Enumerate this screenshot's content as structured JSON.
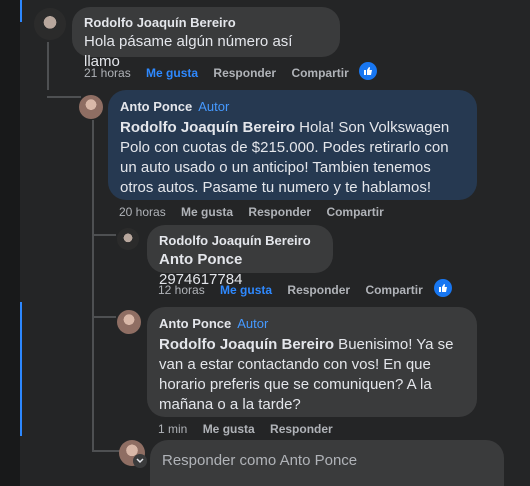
{
  "comment1": {
    "author": "Rodolfo Joaquín Bereiro",
    "text": "Hola pásame algún número así llamo",
    "time": "21 horas",
    "like_label": "Me gusta",
    "reply_label": "Responder",
    "share_label": "Compartir",
    "liked": true
  },
  "reply1": {
    "author": "Anto Ponce",
    "badge": "Autor",
    "mention": "Rodolfo Joaquín Bereiro",
    "text": " Hola! Son Volkswagen Polo con cuotas de $215.000. Podes retirarlo con un auto usado o un anticipo! Tambien tenemos otros autos. Pasame tu numero y te hablamos!",
    "time": "20 horas",
    "like_label": "Me gusta",
    "reply_label": "Responder",
    "share_label": "Compartir"
  },
  "reply2": {
    "author": "Rodolfo Joaquín Bereiro",
    "mention": "Anto Ponce",
    "text": " 2974617784",
    "time": "12 horas",
    "like_label": "Me gusta",
    "reply_label": "Responder",
    "share_label": "Compartir",
    "liked": true
  },
  "reply3": {
    "author": "Anto Ponce",
    "badge": "Autor",
    "mention": "Rodolfo Joaquín Bereiro",
    "text": " Buenisimo! Ya se van a estar contactando con vos! En que horario preferis que se comuniquen? A la mañana o a la tarde?",
    "time": "1 min",
    "like_label": "Me gusta",
    "reply_label": "Responder"
  },
  "reply_box": {
    "placeholder": "Responder como Anto Ponce"
  },
  "colors": {
    "accent": "#2d88ff",
    "highlight_bubble": "#263951",
    "link_blue": "#4599ff"
  }
}
